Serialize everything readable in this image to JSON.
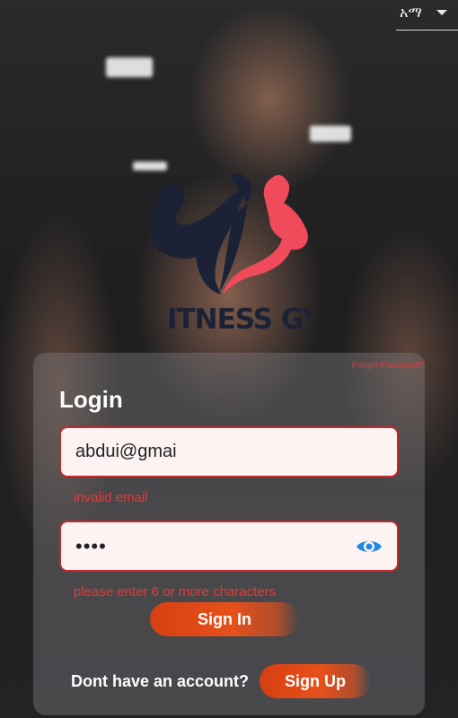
{
  "language": {
    "selected": "አማ",
    "icon": "dropdown-caret-icon"
  },
  "brand": {
    "logo_icon": "fitness-gym-logo-icon",
    "logo_text": "ITNESS GY",
    "colors": {
      "dark": "#1b2236",
      "accent": "#ef4b5a"
    }
  },
  "login": {
    "title": "Login",
    "forgot_password": "Forgot Password?",
    "email_value": "abdui@gmai",
    "email_error": "invalid email",
    "password_masked": "••••",
    "password_error": "please enter 6 or more characters",
    "visibility_icon": "eye-icon",
    "sign_in_label": "Sign In",
    "no_account_text": "Dont have an account?",
    "sign_up_label": "Sign Up"
  },
  "colors": {
    "error": "#e53935",
    "button": "#e8501a",
    "eye": "#1e88e5"
  }
}
